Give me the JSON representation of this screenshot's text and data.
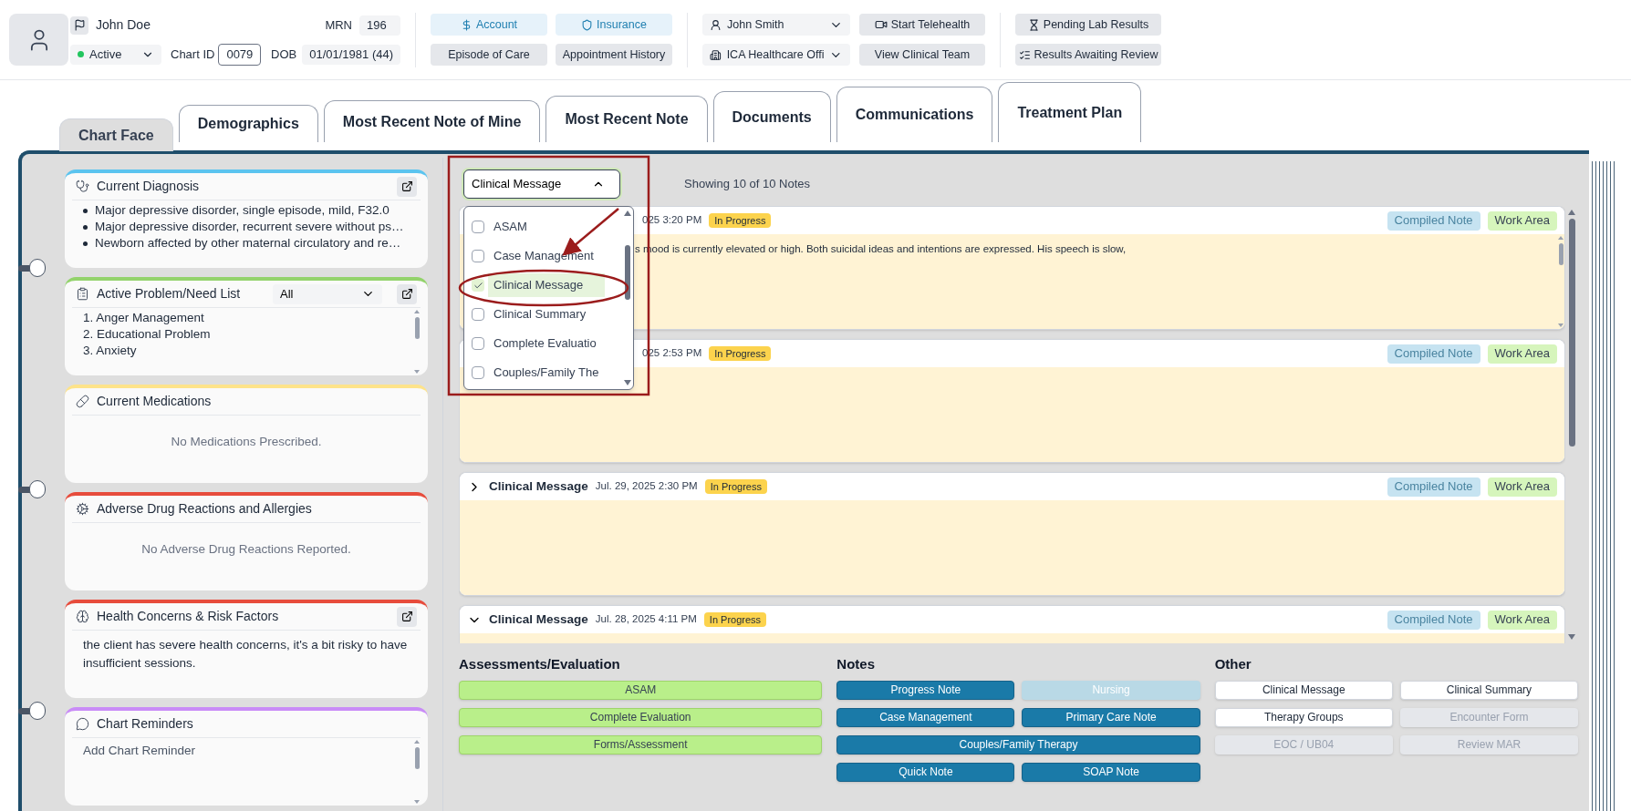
{
  "header": {
    "patient_name": "John Doe",
    "status": {
      "label": "Active",
      "color": "#22c55e"
    },
    "chart_id_label": "Chart ID",
    "chart_id": "0079",
    "mrn_label": "MRN",
    "mrn": "196",
    "dob_label": "DOB",
    "dob": "01/01/1981 (44)",
    "account_buttons": [
      {
        "label": "Account",
        "kind": "link"
      },
      {
        "label": "Insurance",
        "kind": "link"
      },
      {
        "label": "Episode of Care",
        "kind": "plain"
      },
      {
        "label": "Appointment History",
        "kind": "plain"
      }
    ],
    "staff_select": "John Smith",
    "office_select": "ICA Healthcare Offi",
    "care_buttons": [
      {
        "label": "Start Telehealth"
      },
      {
        "label": "View Clinical Team"
      }
    ],
    "lab_buttons": [
      {
        "label": "Pending Lab Results"
      },
      {
        "label": "Results Awaiting Review"
      }
    ]
  },
  "tabs": [
    {
      "label": "Chart Face",
      "selected": true
    },
    {
      "label": "Demographics",
      "selected": false
    },
    {
      "label": "Most Recent Note of Mine",
      "selected": false
    },
    {
      "label": "Most Recent Note",
      "selected": false
    },
    {
      "label": "Documents",
      "selected": false
    },
    {
      "label": "Communications",
      "selected": false
    },
    {
      "label": "Treatment Plan",
      "selected": false
    }
  ],
  "cards": [
    {
      "title": "Current Diagnosis",
      "color": "#5bc4ef",
      "kind": "list",
      "popout": true,
      "items": [
        "Major depressive disorder, single episode, mild, F32.0",
        "Major depressive disorder, recurrent severe without ps…",
        "Newborn affected by other maternal circulatory and re…"
      ]
    },
    {
      "title": "Active Problem/Need List",
      "color": "#93d36b",
      "kind": "numbered",
      "popout": true,
      "filter": "All",
      "items": [
        "1. Anger Management",
        "2. Educational Problem",
        "3. Anxiety"
      ]
    },
    {
      "title": "Current Medications",
      "color": "#fde38a",
      "kind": "empty",
      "popout": false,
      "message": "No Medications Prescribed."
    },
    {
      "title": "Adverse Drug Reactions and Allergies",
      "color": "#e74c3c",
      "kind": "empty",
      "popout": false,
      "message": "No Adverse Drug Reactions Reported."
    },
    {
      "title": "Health Concerns & Risk Factors",
      "color": "#e74c3c",
      "kind": "text",
      "popout": true,
      "text": "the client has severe health concerns, it's a bit risky to have insufficient sessions."
    },
    {
      "title": "Chart Reminders",
      "color": "#c98cf7",
      "kind": "input",
      "popout": false,
      "placeholder": "Add Chart Reminder"
    }
  ],
  "note_filter": {
    "value": "Clinical Message",
    "expanded": true,
    "options": [
      {
        "label": "ASAM",
        "checked": false
      },
      {
        "label": "Case Management",
        "checked": false
      },
      {
        "label": "Clinical Message",
        "checked": true
      },
      {
        "label": "Clinical Summary",
        "checked": false
      },
      {
        "label": "Complete Evaluatio",
        "checked": false
      },
      {
        "label": "Couples/Family The",
        "checked": false
      }
    ]
  },
  "notes_count": "Showing 10 of 10 Notes",
  "notes": [
    {
      "date": "025 3:20 PM",
      "status": "In Progress",
      "body": "s mood is currently elevated or high. Both suicidal ideas and intentions are expressed. His speech is slow,",
      "compiled": "Compiled Note",
      "work": "Work Area"
    },
    {
      "date": "025 2:53 PM",
      "status": "In Progress",
      "compiled": "Compiled Note",
      "work": "Work Area"
    },
    {
      "title": "Clinical Message",
      "expanded": false,
      "date": "Jul. 29, 2025 2:30 PM",
      "status": "In Progress",
      "compiled": "Compiled Note",
      "work": "Work Area"
    },
    {
      "title": "Clinical Message",
      "expanded": true,
      "date": "Jul. 28, 2025 4:11 PM",
      "status": "In Progress",
      "compiled": "Compiled Note",
      "work": "Work Area"
    }
  ],
  "sections": [
    {
      "title": "Assessments/Evaluation",
      "kind": "assessment",
      "rows": [
        [
          {
            "label": "ASAM",
            "disabled": false
          }
        ],
        [
          {
            "label": "Complete Evaluation",
            "disabled": false
          }
        ],
        [
          {
            "label": "Forms/Assessment",
            "disabled": false
          }
        ]
      ]
    },
    {
      "title": "Notes",
      "kind": "note",
      "rows": [
        [
          {
            "label": "Progress Note",
            "disabled": false
          },
          {
            "label": "Nursing",
            "disabled": true
          }
        ],
        [
          {
            "label": "Case Management",
            "disabled": false
          },
          {
            "label": "Primary Care Note",
            "disabled": false
          }
        ],
        [
          {
            "label": "Couples/Family Therapy",
            "disabled": false
          }
        ],
        [
          {
            "label": "Quick Note",
            "disabled": false
          },
          {
            "label": "SOAP Note",
            "disabled": false
          }
        ]
      ]
    },
    {
      "title": "Other",
      "kind": "other",
      "rows": [
        [
          {
            "label": "Clinical Message",
            "disabled": false
          },
          {
            "label": "Clinical Summary",
            "disabled": false
          }
        ],
        [
          {
            "label": "Therapy Groups",
            "disabled": false
          },
          {
            "label": "Encounter Form",
            "disabled": true
          }
        ],
        [
          {
            "label": "EOC / UB04",
            "disabled": true
          },
          {
            "label": "Review MAR",
            "disabled": true
          }
        ]
      ]
    }
  ]
}
